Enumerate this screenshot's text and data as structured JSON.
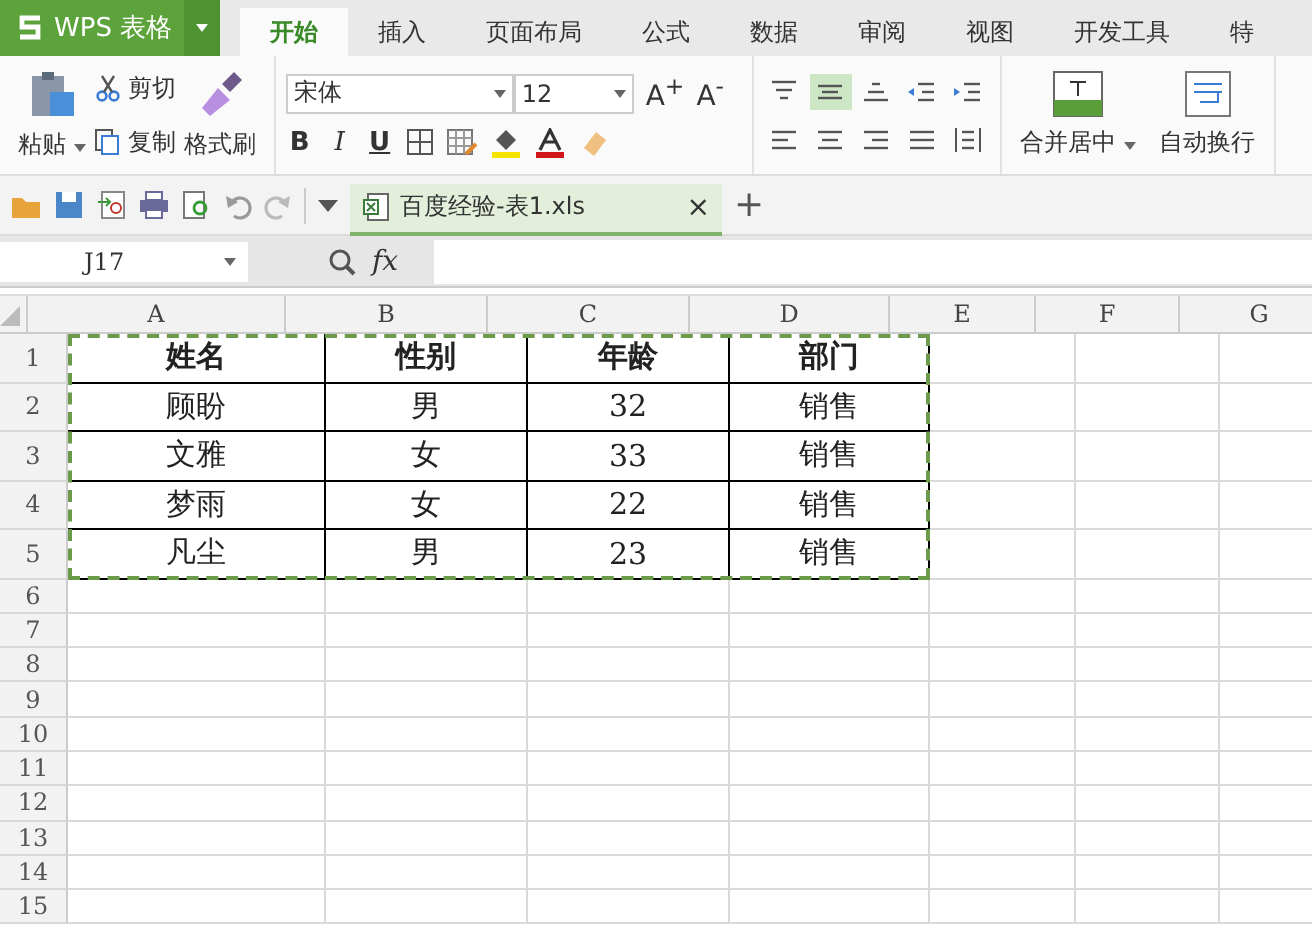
{
  "app": {
    "name": "WPS 表格"
  },
  "menu_tabs": [
    {
      "label": "开始",
      "selected": true
    },
    {
      "label": "插入",
      "selected": false
    },
    {
      "label": "页面布局",
      "selected": false
    },
    {
      "label": "公式",
      "selected": false
    },
    {
      "label": "数据",
      "selected": false
    },
    {
      "label": "审阅",
      "selected": false
    },
    {
      "label": "视图",
      "selected": false
    },
    {
      "label": "开发工具",
      "selected": false
    },
    {
      "label": "特",
      "selected": false
    }
  ],
  "ribbon": {
    "paste": "粘贴",
    "cut": "剪切",
    "copy": "复制",
    "format_painter": "格式刷",
    "font_name": "宋体",
    "font_size": "12",
    "bold": "B",
    "italic": "I",
    "underline": "U",
    "grow_font": "A$^{+}$",
    "shrink_font": "A$^{-}$",
    "merge": "合并居中",
    "wrap": "自动换行",
    "align_buttons": [
      {
        "kind": "top",
        "selected": false
      },
      {
        "kind": "middle",
        "selected": true
      },
      {
        "kind": "bottom",
        "selected": false
      },
      {
        "kind": "outdent",
        "selected": false
      },
      {
        "kind": "indent",
        "selected": false
      },
      {
        "kind": "left",
        "selected": false
      },
      {
        "kind": "center",
        "selected": false
      },
      {
        "kind": "right",
        "selected": false
      },
      {
        "kind": "justify",
        "selected": false
      },
      {
        "kind": "distribute",
        "selected": false
      }
    ]
  },
  "document_tab": {
    "title": "百度经验-表1.xls",
    "close": "×",
    "new": "+"
  },
  "formula_bar": {
    "name_box": "J17",
    "fx": "fx"
  },
  "sheet": {
    "columns": [
      "A",
      "B",
      "C",
      "D",
      "E",
      "F",
      "G"
    ],
    "rows": [
      "1",
      "2",
      "3",
      "4",
      "5",
      "6",
      "7",
      "8",
      "9",
      "10",
      "11",
      "12",
      "13",
      "14",
      "15"
    ],
    "copy_marquee": true,
    "cells": [
      [
        "姓名",
        "性别",
        "年龄",
        "部门"
      ],
      [
        "顾盼",
        "男",
        "32",
        "销售"
      ],
      [
        "文雅",
        "女",
        "33",
        "销售"
      ],
      [
        "梦雨",
        "女",
        "22",
        "销售"
      ],
      [
        "凡尘",
        "男",
        "23",
        "销售"
      ]
    ]
  }
}
